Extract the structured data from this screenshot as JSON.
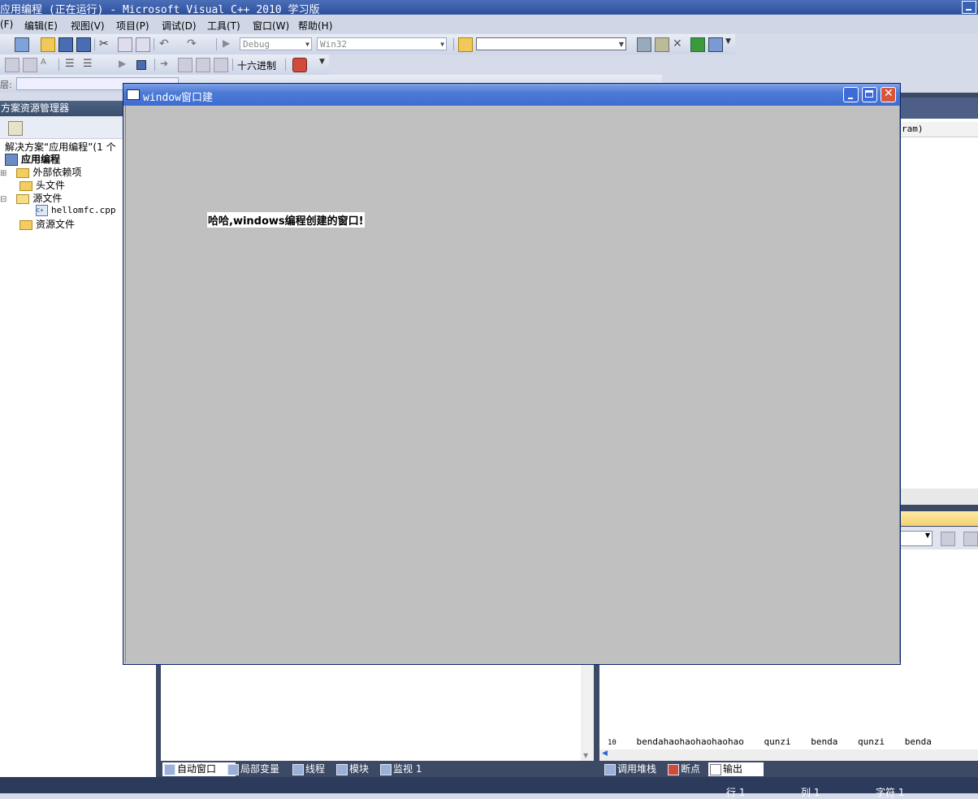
{
  "app": {
    "title": "应用编程 (正在运行) - Microsoft Visual C++ 2010 学习版"
  },
  "menu": [
    {
      "label": "(F)"
    },
    {
      "label": "编辑(E)"
    },
    {
      "label": "视图(V)"
    },
    {
      "label": "项目(P)"
    },
    {
      "label": "调试(D)"
    },
    {
      "label": "工具(T)"
    },
    {
      "label": "窗口(W)"
    },
    {
      "label": "帮助(H)"
    }
  ],
  "toolbar1": {
    "config_combo": "Debug",
    "platform_combo": "Win32",
    "find_combo": ""
  },
  "toolbar2": {
    "hex_label": "十六进制"
  },
  "toolbar3": {
    "label": "层:"
  },
  "solution_explorer": {
    "title": "方案资源管理器",
    "solution_label": "解决方案“应用编程”(1 个",
    "project": "应用编程",
    "nodes": [
      {
        "label": "外部依赖项"
      },
      {
        "label": "头文件"
      },
      {
        "label": "源文件"
      },
      {
        "label": "hellomfc.cpp"
      },
      {
        "label": "资源文件"
      }
    ]
  },
  "right_panel": {
    "partial_text": "ram)"
  },
  "child_window": {
    "title": "window窗口建",
    "message": "哈哈,windows编程创建的窗口!"
  },
  "output_line": {
    "prefix": "10",
    "words": [
      "bendahaohaohaohaohao",
      "qunzi",
      "benda",
      "qunzi",
      "benda"
    ]
  },
  "bottom_tabs_left": [
    {
      "label": "自动窗口",
      "active": true
    },
    {
      "label": "局部变量",
      "active": false
    },
    {
      "label": "线程",
      "active": false
    },
    {
      "label": "模块",
      "active": false
    },
    {
      "label": "监视 1",
      "active": false
    }
  ],
  "bottom_tabs_right": [
    {
      "label": "调用堆栈",
      "active": false
    },
    {
      "label": "断点",
      "active": false
    },
    {
      "label": "输出",
      "active": true
    }
  ],
  "status": {
    "line": "行 1",
    "col": "列 1",
    "char": "字符 1"
  }
}
